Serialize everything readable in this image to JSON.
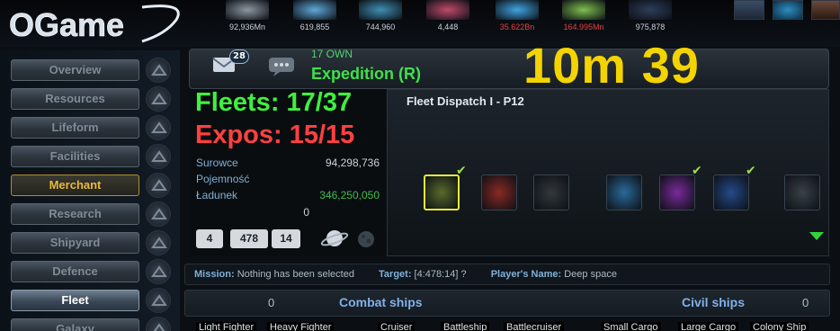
{
  "app": {
    "logo_text": "OGame"
  },
  "resources": [
    {
      "name": "metal",
      "value": "92,936Mn",
      "red": false,
      "color": "#8d96a0"
    },
    {
      "name": "crystal",
      "value": "619,855",
      "red": false,
      "color": "#5fa8d8"
    },
    {
      "name": "deuterium",
      "value": "744,960",
      "red": false,
      "color": "#3f8fb3"
    },
    {
      "name": "energy",
      "value": "4,448",
      "red": false,
      "color": "#c04a6a"
    },
    {
      "name": "population",
      "value": "35.622Bn",
      "red": true,
      "color": "#3fa3e0"
    },
    {
      "name": "food",
      "value": "164.995Mn",
      "red": true,
      "color": "#7fbf4f"
    },
    {
      "name": "dark-matter",
      "value": "975,878",
      "red": false,
      "color": "#2d3d5a"
    }
  ],
  "menu": [
    {
      "id": "overview",
      "label": "Overview",
      "state": "normal"
    },
    {
      "id": "resources",
      "label": "Resources",
      "state": "normal"
    },
    {
      "id": "lifeform",
      "label": "Lifeform",
      "state": "normal"
    },
    {
      "id": "facilities",
      "label": "Facilities",
      "state": "normal"
    },
    {
      "id": "merchant",
      "label": "Merchant",
      "state": "merchant"
    },
    {
      "id": "research",
      "label": "Research",
      "state": "normal"
    },
    {
      "id": "shipyard",
      "label": "Shipyard",
      "state": "normal"
    },
    {
      "id": "defence",
      "label": "Defence",
      "state": "normal"
    },
    {
      "id": "fleet",
      "label": "Fleet",
      "state": "active"
    },
    {
      "id": "galaxy",
      "label": "Galaxy",
      "state": "normal"
    }
  ],
  "header": {
    "messages_count": "28",
    "own_label": "17 OWN",
    "expedition_label": "Expedition (R)",
    "timer": "10m 39"
  },
  "fleetinfo": {
    "fleets": "Fleets: 17/37",
    "expos": "Expos: 15/15",
    "rows": [
      {
        "label": "Surowce",
        "value": "94,298,736"
      },
      {
        "label": "Pojemność",
        "value": ""
      },
      {
        "label": "Ładunek",
        "value": "346,250,050"
      },
      {
        "label": "",
        "value": "0"
      }
    ],
    "coords": [
      "4",
      "478",
      "14"
    ]
  },
  "dispatch": {
    "title": "Fleet Dispatch I - P12",
    "missions": [
      {
        "name": "expedition",
        "selected": true,
        "checked": true
      },
      {
        "name": "attack",
        "selected": false,
        "checked": false
      },
      {
        "name": "colonize",
        "selected": false,
        "checked": false
      },
      {
        "name": "harvest",
        "selected": false,
        "checked": false
      },
      {
        "name": "transport",
        "selected": false,
        "checked": true
      },
      {
        "name": "espionage",
        "selected": false,
        "checked": true
      },
      {
        "name": "recycle",
        "selected": false,
        "checked": false
      }
    ]
  },
  "status": {
    "mission_label": "Mission:",
    "mission_value": "Nothing has been selected",
    "target_label": "Target:",
    "target_value": "[4:478:14] ?",
    "player_label": "Player's Name:",
    "player_value": "Deep space"
  },
  "ships": {
    "combat_count": "0",
    "combat_title": "Combat ships",
    "civil_title": "Civil ships",
    "civil_count": "0",
    "names": [
      "Light Fighter",
      "Heavy Fighter",
      "Cruiser",
      "Battleship",
      "Battlecruiser",
      "Small Cargo",
      "Large Cargo",
      "Colony Ship"
    ]
  }
}
